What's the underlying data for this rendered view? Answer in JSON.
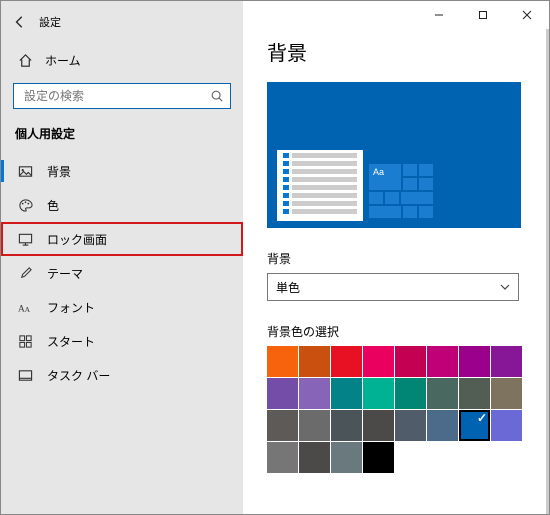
{
  "window": {
    "title": "設定"
  },
  "sidebar": {
    "home": "ホーム",
    "search_placeholder": "設定の検索",
    "section": "個人用設定",
    "items": [
      {
        "id": "background",
        "label": "背景",
        "icon": "image-icon",
        "selected": true
      },
      {
        "id": "color",
        "label": "色",
        "icon": "palette-icon",
        "selected": false
      },
      {
        "id": "lockscreen",
        "label": "ロック画面",
        "icon": "monitor-icon",
        "selected": false,
        "highlight": true
      },
      {
        "id": "theme",
        "label": "テーマ",
        "icon": "brush-icon",
        "selected": false
      },
      {
        "id": "font",
        "label": "フォント",
        "icon": "font-icon",
        "selected": false
      },
      {
        "id": "start",
        "label": "スタート",
        "icon": "start-icon",
        "selected": false
      },
      {
        "id": "taskbar",
        "label": "タスク バー",
        "icon": "taskbar-icon",
        "selected": false
      }
    ]
  },
  "main": {
    "title": "背景",
    "preview_aa": "Aa",
    "background_label": "背景",
    "background_value": "単色",
    "color_section_label": "背景色の選択",
    "colors": [
      "#f7630c",
      "#ca5010",
      "#e81123",
      "#ea005e",
      "#c30052",
      "#bf0077",
      "#9a0089",
      "#881798",
      "#744da9",
      "#8764b8",
      "#038387",
      "#00b294",
      "#018574",
      "#486860",
      "#525e54",
      "#7e735f",
      "#5d5a58",
      "#6b6b6b",
      "#4a5459",
      "#4c4a48",
      "#515c6b",
      "#4c6b8a",
      "#0063b1",
      "#6b69d6",
      "#767676",
      "#4c4a48",
      "#69797e",
      "#000000"
    ],
    "selected_color_index": 22
  }
}
